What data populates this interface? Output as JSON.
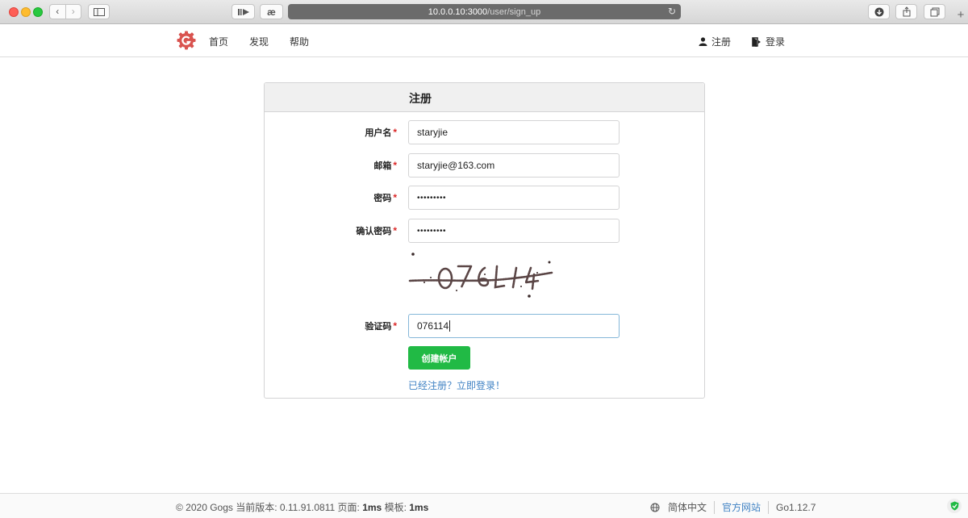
{
  "browser": {
    "url_host": "10.0.0.10:3000",
    "url_path": "/user/sign_up",
    "reader_label": "æ"
  },
  "header": {
    "nav": [
      "首页",
      "发现",
      "帮助"
    ],
    "register": "注册",
    "login": "登录"
  },
  "form": {
    "title": "注册",
    "fields": [
      {
        "label": "用户名",
        "value": "staryjie"
      },
      {
        "label": "邮箱",
        "value": "staryjie@163.com"
      },
      {
        "label": "密码",
        "value": "•••••••••"
      },
      {
        "label": "确认密码",
        "value": "•••••••••"
      }
    ],
    "captcha_label": "验证码",
    "captcha_value": "076114",
    "submit": "创建帐户",
    "login_link": "已经注册？立即登录！"
  },
  "footer": {
    "copyright": "© 2020 Gogs 当前版本: 0.11.91.0811 页面:",
    "page_time": "1ms",
    "template_label": "模板:",
    "template_time": "1ms",
    "language": "简体中文",
    "official_site": "官方网站",
    "go_version": "Go1.12.7"
  },
  "colors": {
    "brand": "#d9534f",
    "submit": "#21ba45",
    "link": "#4183c4",
    "required": "#db2828"
  }
}
